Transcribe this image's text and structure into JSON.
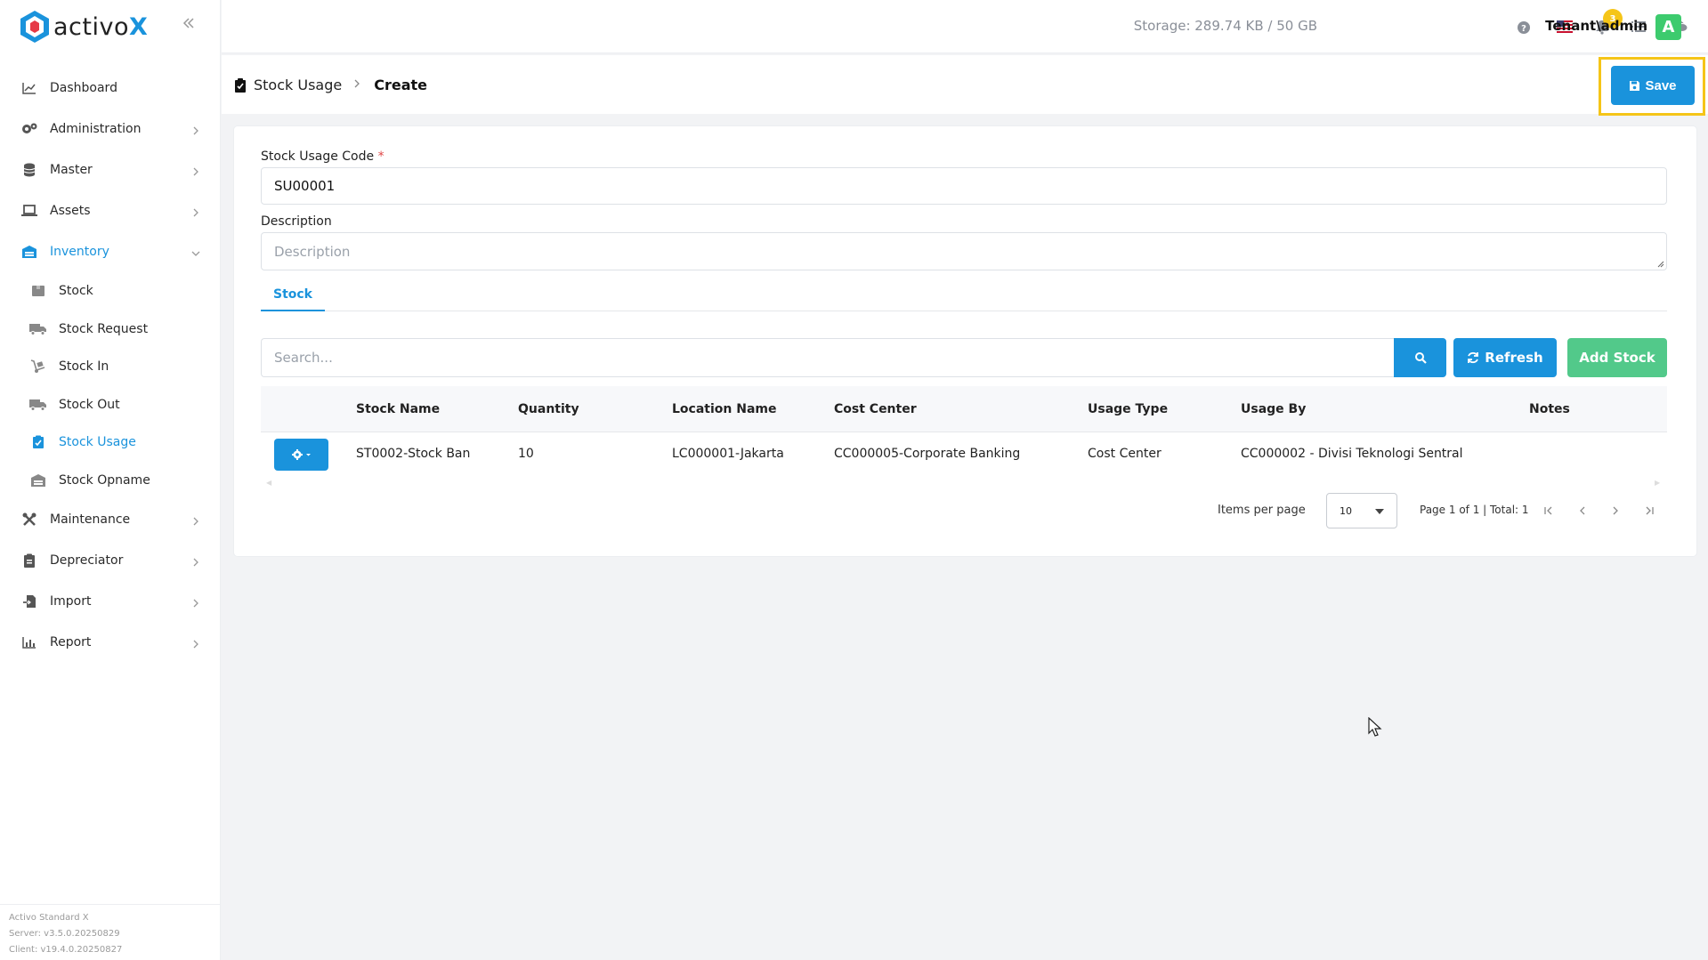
{
  "brand": {
    "logo_text_a": "activo",
    "logo_text_b": "X"
  },
  "sidebar": {
    "items": [
      {
        "label": "Dashboard",
        "icon": "chart-line-icon"
      },
      {
        "label": "Administration",
        "icon": "cogs-icon"
      },
      {
        "label": "Master",
        "icon": "database-icon"
      },
      {
        "label": "Assets",
        "icon": "laptop-icon"
      },
      {
        "label": "Inventory",
        "icon": "warehouse-icon"
      },
      {
        "label": "Maintenance",
        "icon": "tools-icon"
      },
      {
        "label": "Depreciator",
        "icon": "clipboard-icon"
      },
      {
        "label": "Import",
        "icon": "file-import-icon"
      },
      {
        "label": "Report",
        "icon": "chart-bar-icon"
      }
    ],
    "inventory_sub": [
      {
        "label": "Stock",
        "icon": "box-icon"
      },
      {
        "label": "Stock Request",
        "icon": "truck-icon"
      },
      {
        "label": "Stock In",
        "icon": "dolly-icon"
      },
      {
        "label": "Stock Out",
        "icon": "truck-out-icon"
      },
      {
        "label": "Stock Usage",
        "icon": "clipboard-check-icon"
      },
      {
        "label": "Stock Opname",
        "icon": "warehouse-icon"
      }
    ],
    "version": {
      "product": "Activo Standard X",
      "server": "Server: v3.5.0.20250829",
      "client": "Client: v19.4.0.20250827"
    }
  },
  "topbar": {
    "storage": "Storage: 289.74 KB / 50 GB",
    "notification_count": "3",
    "user": "Tenant\\admin",
    "avatar_letter": "A"
  },
  "header": {
    "breadcrumb_parent": "Stock Usage",
    "breadcrumb_current": "Create",
    "save_label": "Save"
  },
  "form": {
    "code_label": "Stock Usage Code",
    "code_required_mark": "*",
    "code_value": "SU00001",
    "description_label": "Description",
    "description_placeholder": "Description"
  },
  "tabs": [
    {
      "label": "Stock"
    }
  ],
  "toolbar": {
    "search_placeholder": "Search...",
    "refresh_label": "Refresh",
    "add_label": "Add Stock"
  },
  "table": {
    "columns": [
      "Stock Name",
      "Quantity",
      "Location Name",
      "Cost Center",
      "Usage Type",
      "Usage By",
      "Notes"
    ],
    "rows": [
      [
        "ST0002-Stock Ban",
        "10",
        "LC000001-Jakarta",
        "CC000005-Corporate Banking",
        "Cost Center",
        "CC000002 - Divisi Teknologi Sentral",
        ""
      ]
    ]
  },
  "pager": {
    "items_per_page_label": "Items per page",
    "items_per_page_value": "10",
    "page_info": "Page 1 of 1 | Total: 1"
  },
  "colors": {
    "accent": "#1a93dc",
    "success": "#52c98a",
    "highlight": "#f5c518"
  }
}
